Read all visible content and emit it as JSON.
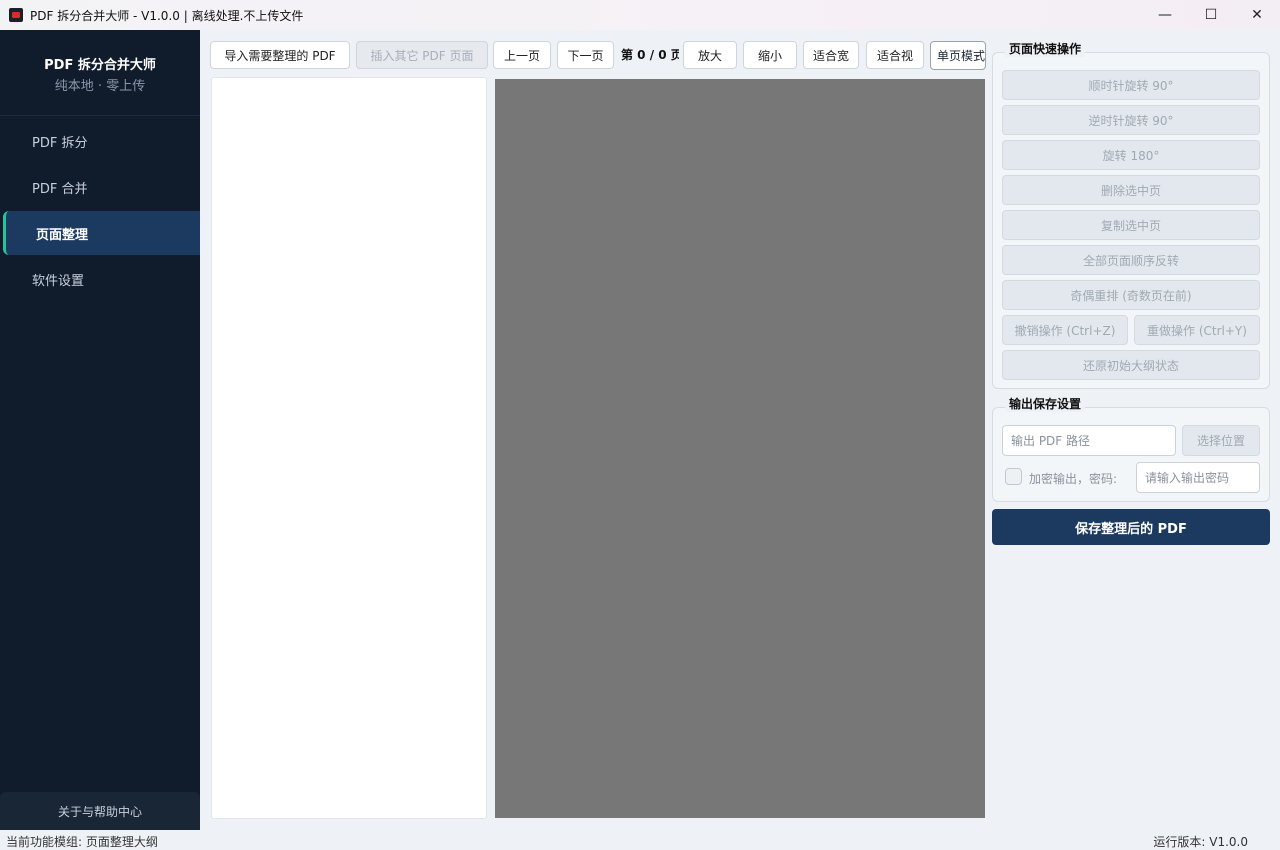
{
  "window": {
    "title": "PDF 拆分合并大师 - V1.0.0 | 离线处理.不上传文件",
    "min_glyph": "—",
    "max_glyph": "☐",
    "close_glyph": "✕"
  },
  "sidebar": {
    "brand_title": "PDF 拆分合并大师",
    "brand_subtitle": "纯本地 · 零上传",
    "items": [
      {
        "label": "PDF 拆分",
        "active": false
      },
      {
        "label": "PDF 合并",
        "active": false
      },
      {
        "label": "页面整理",
        "active": true
      },
      {
        "label": "软件设置",
        "active": false
      }
    ],
    "help_label": "关于与帮助中心",
    "accent": "#22c49a"
  },
  "toolbar": {
    "import_label": "导入需要整理的 PDF",
    "insert_label": "插入其它 PDF 页面",
    "prev_label": "上一页",
    "next_label": "下一页",
    "page_indicator": "第 0 / 0 页",
    "zoom_in_label": "放大",
    "zoom_out_label": "缩小",
    "fit_width_label": "适合宽",
    "fit_view_label": "适合视",
    "mode_value": "单页模式"
  },
  "quick_ops": {
    "title": "页面快速操作",
    "rotate_cw": "顺时针旋转 90°",
    "rotate_ccw": "逆时针旋转 90°",
    "rotate_180": "旋转 180°",
    "delete_selected": "删除选中页",
    "copy_selected": "复制选中页",
    "reverse_all": "全部页面顺序反转",
    "odd_even": "奇偶重排 (奇数页在前)",
    "undo": "撤销操作 (Ctrl+Z)",
    "redo": "重做操作 (Ctrl+Y)",
    "restore": "还原初始大纲状态"
  },
  "output": {
    "title": "输出保存设置",
    "path_placeholder": "输出 PDF 路径",
    "choose_label": "选择位置",
    "encrypt_label": "加密输出，密码:",
    "encrypt_checked": false,
    "password_placeholder": "请输入输出密码",
    "save_label": "保存整理后的 PDF"
  },
  "status": {
    "left": "当前功能模组: 页面整理大纲",
    "right": "运行版本: V1.0.0"
  },
  "colors": {
    "sidebar_bg": "#101c2c",
    "primary": "#1c3a5f",
    "preview_bg": "#777777"
  }
}
